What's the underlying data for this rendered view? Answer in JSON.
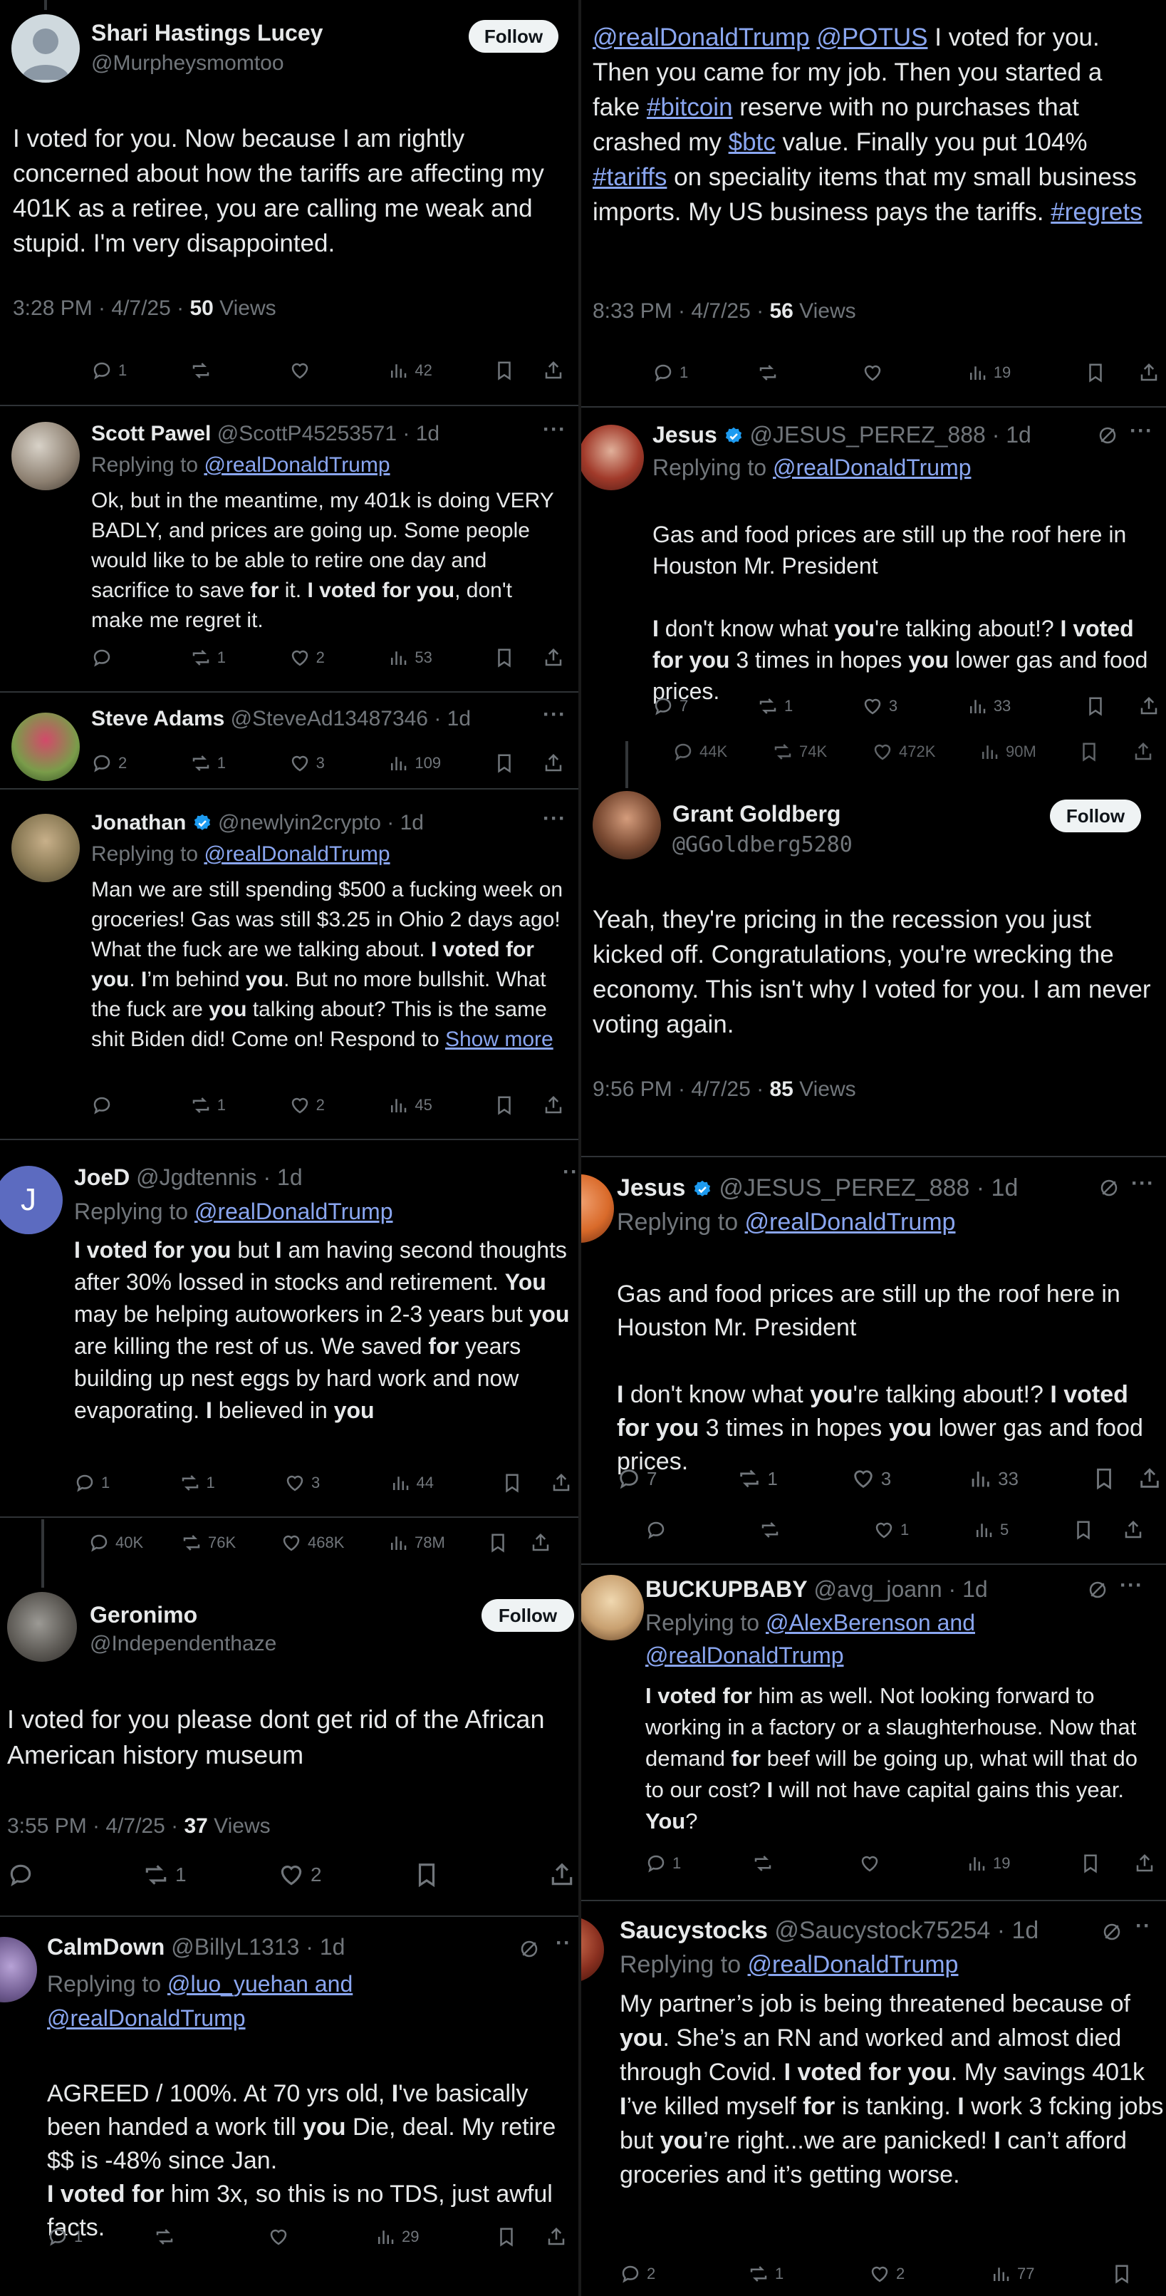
{
  "tiles": [
    {
      "id": "t1",
      "name": "Shari Hastings Lucey",
      "handle": "@Murpheysmomtoo",
      "follow": "Follow",
      "text": "I voted for you.  Now because I am rightly concerned about how the tariffs are affecting my 401K as a retiree, you are calling me weak and stupid.  I'm very disappointed.",
      "time": "3:28 PM · 4/7/25 · ",
      "views_count": "50",
      "views_label": " Views",
      "replies": "1",
      "reposts": "",
      "likes": "",
      "views": "42"
    },
    {
      "id": "t2",
      "segments": [
        "@realDonaldTrump",
        " ",
        "@POTUS",
        " I voted for you. Then you came for my job. Then you started a fake ",
        "#bitcoin",
        " reserve with no purchases that crashed my ",
        "$btc",
        " value. Finally you put 104% ",
        "#tariffs",
        " on speciality items that my small business imports.  My US business pays the tariffs. ",
        "#regrets"
      ],
      "time": "8:33 PM · 4/7/25 · ",
      "views_count": "56",
      "views_label": " Views",
      "replies": "1",
      "reposts": "",
      "likes": "",
      "views": "19"
    },
    {
      "id": "t3",
      "name": "Scott Pawel",
      "handle": "@ScottP45253571 · 1d",
      "replying": "Replying to ",
      "replying_to": "@realDonaldTrump",
      "text_segments": [
        "Ok, but in the meantime, my 401k is doing VERY BADLY, and prices are going up. Some people would like to be able to retire one day and sacrifice to save ",
        "for",
        " it. ",
        "I voted for you",
        ", don't make me regret it."
      ],
      "replies": "",
      "reposts": "1",
      "likes": "2",
      "views": "53"
    },
    {
      "id": "t4",
      "name": "Steve Adams",
      "handle": "@SteveAd13487346 · 1d",
      "replies": "2",
      "reposts": "1",
      "likes": "3",
      "views": "109"
    },
    {
      "id": "t5",
      "name": "Jonathan",
      "handle": "@newlyin2crypto · 1d",
      "replying": "Replying to ",
      "replying_to": "@realDonaldTrump",
      "text_segments": [
        "Man we are still spending $500 a fucking week on groceries! Gas was still $3.25 in Ohio 2 days ago! What the fuck are we talking about. ",
        "I voted for you",
        ". ",
        "I",
        "’m behind ",
        "you",
        ". But no more bullshit. What the fuck are ",
        "you",
        " talking about? This is the same shit Biden did! Come on! Respond to "
      ],
      "show_more": "Show more",
      "replies": "",
      "reposts": "1",
      "likes": "2",
      "views": "45"
    },
    {
      "id": "t6",
      "name": "JoeD",
      "avatar_letter": "J",
      "handle": "@Jgdtennis · 1d",
      "replying": "Replying to ",
      "replying_to": "@realDonaldTrump",
      "text_segments": [
        "I voted for you",
        " but ",
        "I",
        " am having second thoughts after 30% lossed in stocks and retirement. ",
        "You",
        " may be helping autoworkers in 2-3 years but ",
        "you",
        " are killing the rest of us. We saved ",
        "for",
        " years building up nest eggs by hard work and now evaporating. ",
        "I",
        " believed in ",
        "you"
      ],
      "replies": "1",
      "reposts": "1",
      "likes": "3",
      "views": "44"
    },
    {
      "id": "t7",
      "name": "Geronimo",
      "handle": "@Independenthaze",
      "follow": "Follow",
      "top_replies": "40K",
      "top_reposts": "76K",
      "top_likes": "468K",
      "top_views": "78M",
      "text": "I voted for you please dont get rid of the African American history museum",
      "time": "3:55 PM · 4/7/25 · ",
      "views_count": "37",
      "views_label": " Views",
      "replies": "",
      "reposts": "1",
      "likes": "2"
    },
    {
      "id": "t8",
      "name": "CalmDown",
      "handle": "@BillyL1313 · 1d",
      "replying": "Replying to ",
      "replying_to": "@luo_yuehan and @realDonaldTrump",
      "text_segments": [
        "AGREED / 100%. At 70 yrs old, ",
        "I",
        "'ve basically been handed a work till ",
        "you",
        " Die, deal. My retire $$ is -48% since Jan.\n",
        "I voted for",
        " him 3x, so this is no TDS, just awful facts."
      ],
      "replies": "1",
      "reposts": "",
      "likes": "",
      "views": "29"
    },
    {
      "id": "t9",
      "name": "Jesus",
      "handle": "@JESUS_PEREZ_888 · 1d",
      "replying": "Replying to ",
      "replying_to": "@realDonaldTrump",
      "text_segments": [
        "Gas and food prices are still up the roof here in Houston Mr. President\n\n",
        "I",
        " don't know what ",
        "you",
        "'re talking about!? ",
        "I voted for you",
        " 3 times in hopes ",
        "you",
        " lower gas and food prices."
      ],
      "replies": "7",
      "reposts": "1",
      "likes": "3",
      "views": "33",
      "bottom_replies": "44K",
      "bottom_reposts": "74K",
      "bottom_likes": "472K",
      "bottom_views": "90M"
    },
    {
      "id": "t10",
      "name": "Grant Goldberg",
      "handle": "@GGoldberg5280",
      "follow": "Follow",
      "text": "Yeah, they're pricing in the recession you just kicked off. Congratulations, you're wrecking the economy. This isn't why I voted for you. I am never voting again.",
      "time": "9:56 PM · 4/7/25 · ",
      "views_count": "85",
      "views_label": " Views"
    },
    {
      "id": "t11",
      "name": "Jesus",
      "handle": "@JESUS_PEREZ_888 · 1d",
      "replying": "Replying to ",
      "replying_to": "@realDonaldTrump",
      "text_segments": [
        "Gas and food prices are still up the roof here in Houston Mr. President\n\n",
        "I",
        " don't know what ",
        "you",
        "'re talking about!? ",
        "I voted for you",
        " 3 times in hopes ",
        "you",
        " lower gas and food prices."
      ],
      "replies": "7",
      "reposts": "1",
      "likes": "3",
      "views": "33",
      "bottom_replies": "",
      "bottom_reposts": "",
      "bottom_likes": "1",
      "bottom_views": "5"
    },
    {
      "id": "t12",
      "name": "BUCKUPBABY",
      "handle": "@avg_joann · 1d",
      "replying": "Replying to ",
      "replying_to": "@AlexBerenson and @realDonaldTrump",
      "text_segments": [
        "I voted for",
        " him as well. Not looking forward to working in a factory or a slaughterhouse. Now that demand ",
        "for",
        " beef will be going up, what will that do to our cost? ",
        "I",
        " will not have capital gains this year. ",
        "You",
        "?"
      ],
      "replies": "1",
      "reposts": "",
      "likes": "",
      "views": "19"
    },
    {
      "id": "t13",
      "name": "Saucystocks",
      "handle": "@Saucystock75254 · 1d",
      "replying": "Replying to ",
      "replying_to": "@realDonaldTrump",
      "text_segments": [
        "My partner’s job is being threatened because of ",
        "you",
        ". She’s an RN and worked and almost died through Covid. ",
        "I voted for you",
        ". My savings 401k ",
        "I",
        "’ve killed myself ",
        "for",
        " is tanking. ",
        "I",
        " work 3 fcking jobs but ",
        "you",
        "’re right...we are panicked! ",
        "I",
        " can’t afford groceries and it’s getting worse."
      ],
      "replies": "2",
      "reposts": "1",
      "likes": "2",
      "views": "77"
    }
  ]
}
